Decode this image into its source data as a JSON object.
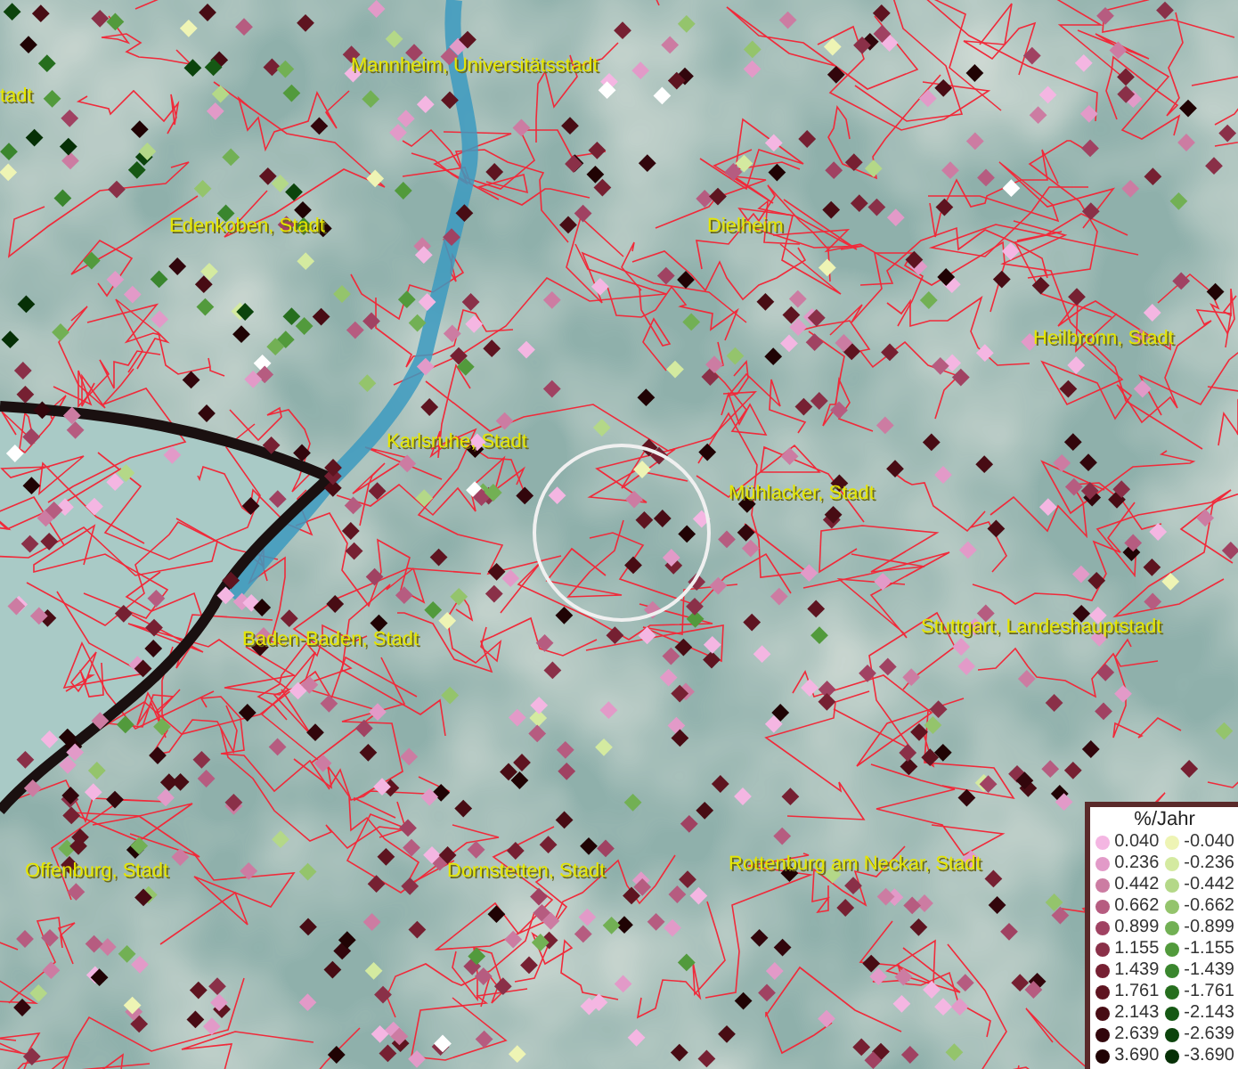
{
  "map": {
    "place_labels": [
      {
        "text": "Mannheim, Universitätsstadt"
      },
      {
        "text": "tadt"
      },
      {
        "text": "Edenkoben, Stadt"
      },
      {
        "text": "Dielheim"
      },
      {
        "text": "Heilbronn, Stadt"
      },
      {
        "text": "Karlsruhe, Stadt"
      },
      {
        "text": "Mühlacker, Stadt"
      },
      {
        "text": "Baden-Baden, Stadt"
      },
      {
        "text": "Stuttgart, Landeshauptstadt"
      },
      {
        "text": "Offenburg, Stadt"
      },
      {
        "text": "Dornstetten, Stadt"
      },
      {
        "text": "Rottenburg am Neckar, Stadt"
      }
    ]
  },
  "legend": {
    "title": "%/Jahr",
    "rows": [
      {
        "positive": {
          "label": "0.040",
          "color": "#f4b6e2"
        },
        "negative": {
          "label": "-0.040",
          "color": "#eef4b4"
        }
      },
      {
        "positive": {
          "label": "0.236",
          "color": "#e29ac8"
        },
        "negative": {
          "label": "-0.236",
          "color": "#d4eaa0"
        }
      },
      {
        "positive": {
          "label": "0.442",
          "color": "#cc7ca2"
        },
        "negative": {
          "label": "-0.442",
          "color": "#b4d888"
        }
      },
      {
        "positive": {
          "label": "0.662",
          "color": "#b65c80"
        },
        "negative": {
          "label": "-0.662",
          "color": "#94c46c"
        }
      },
      {
        "positive": {
          "label": "0.899",
          "color": "#a04262"
        },
        "negative": {
          "label": "-0.899",
          "color": "#72b054"
        }
      },
      {
        "positive": {
          "label": "1.155",
          "color": "#8a3048"
        },
        "negative": {
          "label": "-1.155",
          "color": "#529a3c"
        }
      },
      {
        "positive": {
          "label": "1.439",
          "color": "#762032"
        },
        "negative": {
          "label": "-1.439",
          "color": "#3a862e"
        }
      },
      {
        "positive": {
          "label": "1.761",
          "color": "#5e1420"
        },
        "negative": {
          "label": "-1.761",
          "color": "#266e1e"
        }
      },
      {
        "positive": {
          "label": "2.143",
          "color": "#480c14"
        },
        "negative": {
          "label": "-2.143",
          "color": "#165814"
        }
      },
      {
        "positive": {
          "label": "2.639",
          "color": "#32060c"
        },
        "negative": {
          "label": "-2.639",
          "color": "#0c440c"
        }
      },
      {
        "positive": {
          "label": "3.690",
          "color": "#200304"
        },
        "negative": {
          "label": "-3.690",
          "color": "#063006"
        }
      }
    ]
  }
}
